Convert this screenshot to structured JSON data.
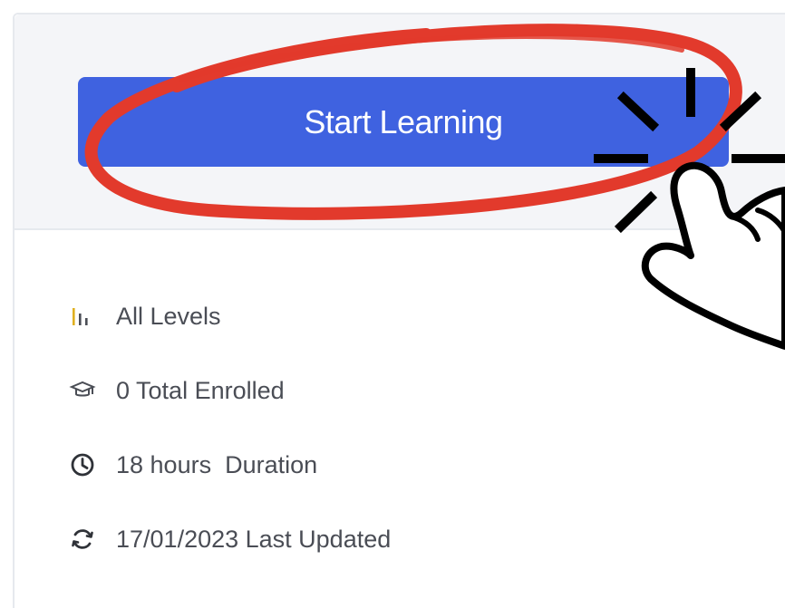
{
  "course_card": {
    "cta_label": "Start Learning",
    "meta": [
      {
        "icon": "level-bars-icon",
        "text": "All Levels"
      },
      {
        "icon": "graduation-cap-icon",
        "text": "0 Total Enrolled"
      },
      {
        "icon": "clock-icon",
        "text": "18 hours  Duration"
      },
      {
        "icon": "refresh-icon",
        "text": "17/01/2023 Last Updated"
      }
    ]
  },
  "colors": {
    "button": "#3f62e0",
    "highlight_ring": "#e23a2c",
    "text": "#4a4d55",
    "card_top_bg": "#f4f5f8"
  }
}
